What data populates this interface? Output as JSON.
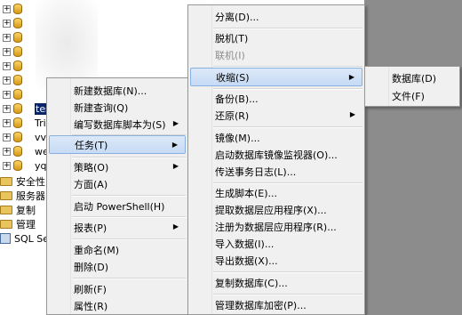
{
  "tree": {
    "db_items": [
      "tes",
      "Tri",
      "vvi",
      "wen",
      "yqw"
    ],
    "folders": [
      "安全性",
      "服务器",
      "复制",
      "管理"
    ],
    "agent": "SQL Se"
  },
  "context_menu": {
    "items": [
      "新建数据库(N)...",
      "新建查询(Q)",
      "编写数据库脚本为(S)",
      "任务(T)",
      "策略(O)",
      "方面(A)",
      "启动 PowerShell(H)",
      "报表(P)",
      "重命名(M)",
      "删除(D)",
      "刷新(F)",
      "属性(R)"
    ]
  },
  "tasks_menu": {
    "items": [
      "分离(D)...",
      "脱机(T)",
      "联机(I)",
      "收缩(S)",
      "备份(B)...",
      "还原(R)",
      "镜像(M)...",
      "启动数据库镜像监视器(O)...",
      "传送事务日志(L)...",
      "生成脚本(E)...",
      "提取数据层应用程序(X)...",
      "注册为数据层应用程序(R)...",
      "导入数据(I)...",
      "导出数据(X)...",
      "复制数据库(C)...",
      "管理数据库加密(P)..."
    ]
  },
  "shrink_menu": {
    "items": [
      "数据库(D)",
      "文件(F)"
    ]
  },
  "colors": {
    "selection": "#c6dbf5",
    "menu_bg": "#f0f0f0",
    "disabled": "#8d8d8d"
  }
}
